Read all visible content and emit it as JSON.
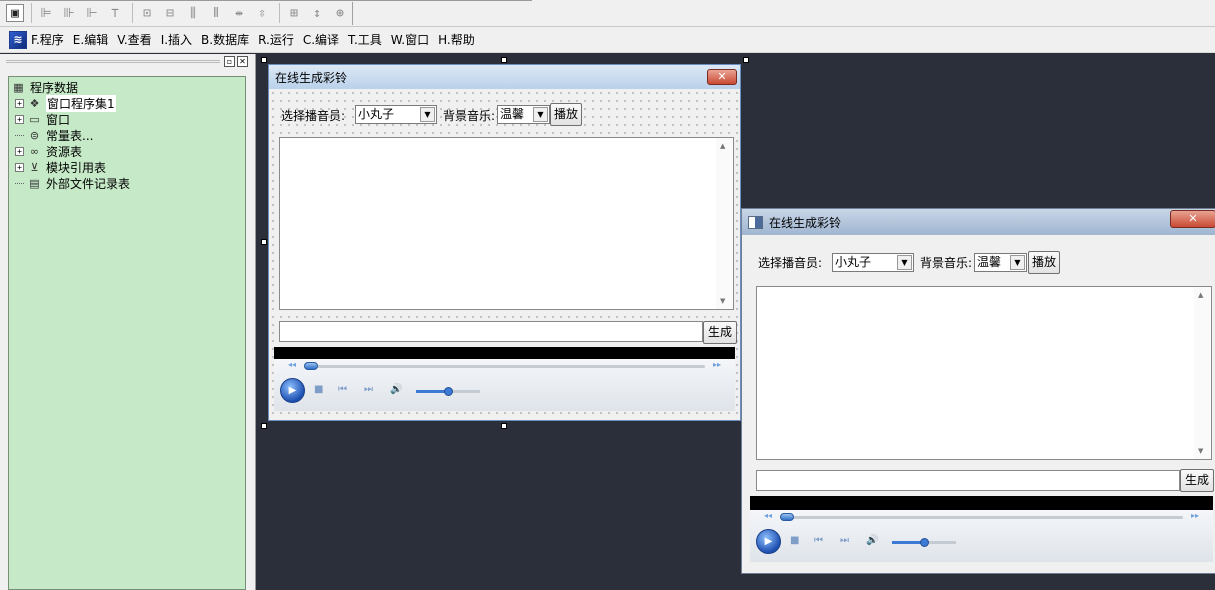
{
  "toolbar": {
    "icons": [
      "form-icon",
      "align-left-icon",
      "align-center-icon",
      "align-right-icon",
      "align-top-icon",
      "align-middle-icon",
      "align-bottom-icon",
      "distribute-horizontal-icon",
      "distribute-vertical-icon",
      "same-width-icon",
      "same-height-icon",
      "same-size-icon"
    ]
  },
  "menubar": {
    "items": [
      "F.程序",
      "E.编辑",
      "V.查看",
      "I.插入",
      "B.数据库",
      "R.运行",
      "C.编译",
      "T.工具",
      "W.窗口",
      "H.帮助"
    ]
  },
  "tree": {
    "root": "程序数据",
    "items": [
      {
        "label": "窗口程序集1",
        "icon": "assembly-icon",
        "expandable": true,
        "selected": true
      },
      {
        "label": "窗口",
        "icon": "window-icon",
        "expandable": true
      },
      {
        "label": "常量表...",
        "icon": "constant-icon",
        "expandable": false
      },
      {
        "label": "资源表",
        "icon": "resource-icon",
        "expandable": true
      },
      {
        "label": "模块引用表",
        "icon": "module-icon",
        "expandable": true
      },
      {
        "label": "外部文件记录表",
        "icon": "file-icon",
        "expandable": false
      }
    ]
  },
  "design_window": {
    "title": "在线生成彩铃",
    "close_label": "✕",
    "announcer_label": "选择播音员:",
    "announcer_value": "小丸子",
    "music_label": "背景音乐:",
    "music_value": "温馨",
    "play_button": "播放",
    "generate_button": "生成",
    "text_value": "",
    "player_volume": 0.5,
    "player_progress": 0.0
  },
  "preview_window": {
    "title": "在线生成彩铃",
    "close_label": "✕",
    "announcer_label": "选择播音员:",
    "announcer_value": "小丸子",
    "music_label": "背景音乐:",
    "music_value": "温馨",
    "play_button": "播放",
    "generate_button": "生成",
    "text_value": "",
    "player_volume": 0.5,
    "player_progress": 0.0
  }
}
